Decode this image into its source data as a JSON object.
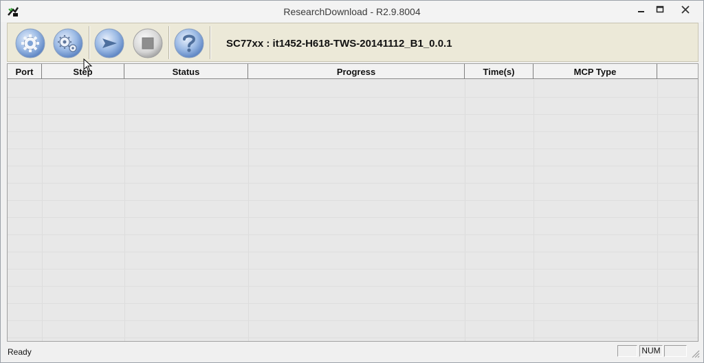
{
  "window": {
    "title": "ResearchDownload - R2.9.8004",
    "minimize_label": "–",
    "maximize_label": "□",
    "close_label": "✕"
  },
  "toolbar": {
    "buttons": [
      {
        "name": "load-packet-button",
        "icon": "gear-icon"
      },
      {
        "name": "settings-button",
        "icon": "settings-gears-icon"
      },
      {
        "name": "start-download-button",
        "icon": "play-icon"
      },
      {
        "name": "stop-download-button",
        "icon": "stop-icon"
      },
      {
        "name": "help-button",
        "icon": "help-icon"
      }
    ],
    "product_label": "SC77xx : it1452-H618-TWS-20141112_B1_0.0.1"
  },
  "grid": {
    "columns": [
      "Port",
      "Step",
      "Status",
      "Progress",
      "Time(s)",
      "MCP Type",
      ""
    ],
    "rows": []
  },
  "statusbar": {
    "status": "Ready",
    "panels": [
      "",
      "NUM",
      ""
    ]
  },
  "colors": {
    "toolbar_bg": "#ece9d8",
    "grid_bg": "#e8e8e8",
    "button_blue": "#7fa6d9"
  }
}
